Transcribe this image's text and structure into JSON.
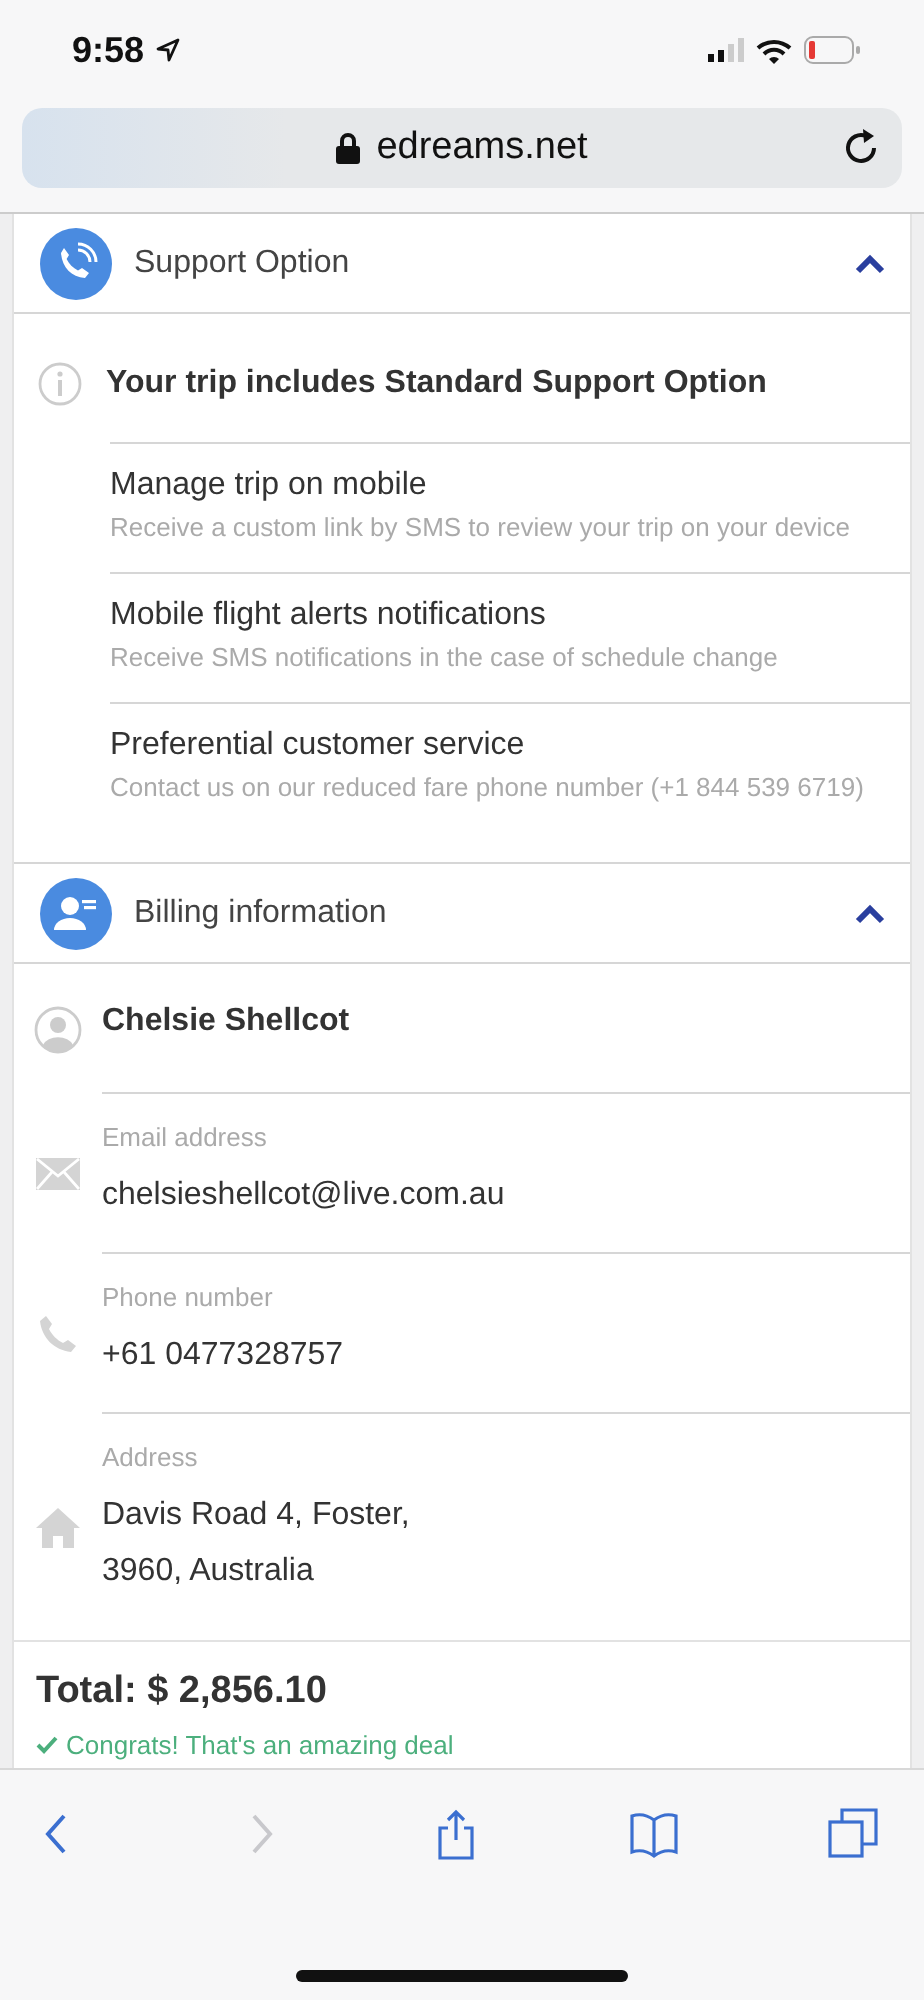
{
  "status_bar": {
    "time": "9:58"
  },
  "address_bar": {
    "url": "edreams.net"
  },
  "sections": [
    {
      "kind": "support",
      "title": "Support Option",
      "expanded": true,
      "headline": "Your trip includes Standard Support Option",
      "items": [
        {
          "title": "Manage trip on mobile",
          "description": "Receive a custom link by SMS to review your trip on your device"
        },
        {
          "title": "Mobile flight alerts notifications",
          "description": "Receive SMS notifications in the case of schedule change"
        },
        {
          "title": "Preferential customer service",
          "description": "Contact us on our reduced fare phone number (+1 844 539 6719)"
        }
      ]
    },
    {
      "kind": "billing",
      "title": "Billing information",
      "expanded": true,
      "fields": [
        {
          "kind": "name",
          "value": "Chelsie Shellcot"
        },
        {
          "kind": "email",
          "label": "Email address",
          "value": "chelsieshellcot@live.com.au"
        },
        {
          "kind": "phone",
          "label": "Phone number",
          "value": "+61 0477328757"
        },
        {
          "kind": "address",
          "label": "Address",
          "lines": [
            "Davis Road 4, Foster,",
            "3960, Australia"
          ]
        }
      ]
    }
  ],
  "total": {
    "amount": "Total: $ 2,856.10",
    "note": "Congrats! That's an amazing deal"
  },
  "toolbar": [
    {
      "kind": "back",
      "disabled": false
    },
    {
      "kind": "forward",
      "disabled": true
    },
    {
      "kind": "share",
      "disabled": false
    },
    {
      "kind": "bookmarks",
      "disabled": false
    },
    {
      "kind": "tabs",
      "disabled": false
    }
  ]
}
